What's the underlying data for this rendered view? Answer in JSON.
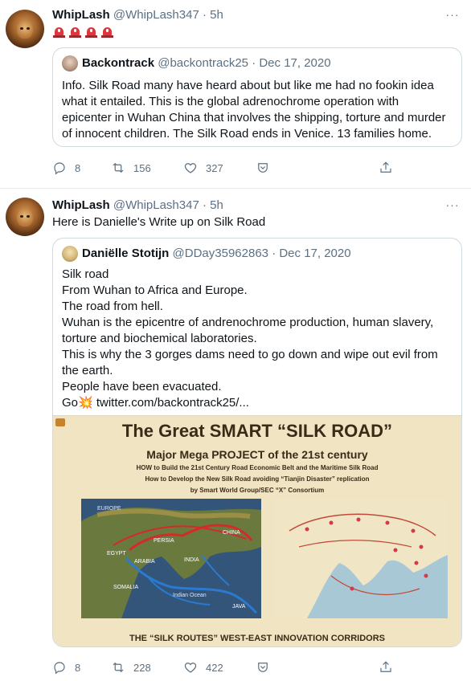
{
  "tweets": [
    {
      "author_name": "WhipLash",
      "author_handle": "@WhipLash347",
      "time": "· 5h",
      "text": "",
      "emoji_count": 4,
      "quote": {
        "author_name": "Backontrack",
        "author_handle": "@backontrack25",
        "date": "· Dec 17, 2020",
        "lines": [
          "Info.  Silk Road many have heard about but like me had no fookin idea",
          "what it entailed. This is the global adrenochrome operation with",
          "epicenter in Wuhan China that involves the shipping, torture and murder",
          "of innocent children. The Silk Road ends in Venice.  13 families home."
        ]
      },
      "actions": {
        "replies": "8",
        "retweets": "156",
        "likes": "327"
      }
    },
    {
      "author_name": "WhipLash",
      "author_handle": "@WhipLash347",
      "time": "· 5h",
      "text": "Here is Danielle's Write up on Silk Road",
      "quote": {
        "author_name": "Daniëlle Stotijn",
        "author_handle": "@DDay35962863",
        "date": "· Dec 17, 2020",
        "lines": [
          "Silk road",
          "From Wuhan to Africa and Europe.",
          "The road from hell.",
          "Wuhan is the epicentre of andrenochrome production, human slavery,",
          "torture and biochemical laboratories.",
          "This is why the 3 gorges dams need to go down and wipe out evil from",
          "the earth.",
          "People have been evacuated.",
          "Go💥  twitter.com/backontrack25/..."
        ],
        "image": {
          "title": "The Great SMART “SILK ROAD”",
          "subtitle": "Major Mega PROJECT of the 21st century",
          "line1": "HOW to Build the 21st Century Road Economic Belt and the Maritime Silk Road",
          "line2": "How to Develop the New Silk Road avoiding “Tianjin Disaster” replication",
          "line3": "by Smart World Group/SEC “X” Consortium",
          "map_labels": [
            "EUROPE",
            "EGYPT",
            "ARABIA",
            "PERSIA",
            "INDIA",
            "CHINA",
            "SOMALIA",
            "Indian Ocean",
            "JAVA"
          ],
          "footer": "THE “SILK ROUTES” WEST-EAST INNOVATION CORRIDORS"
        }
      },
      "actions": {
        "replies": "8",
        "retweets": "228",
        "likes": "422"
      }
    }
  ],
  "more_icon": "···",
  "colors": {
    "accent": "#1da1f2",
    "muted": "#5b7083",
    "border": "#cfd9de"
  }
}
